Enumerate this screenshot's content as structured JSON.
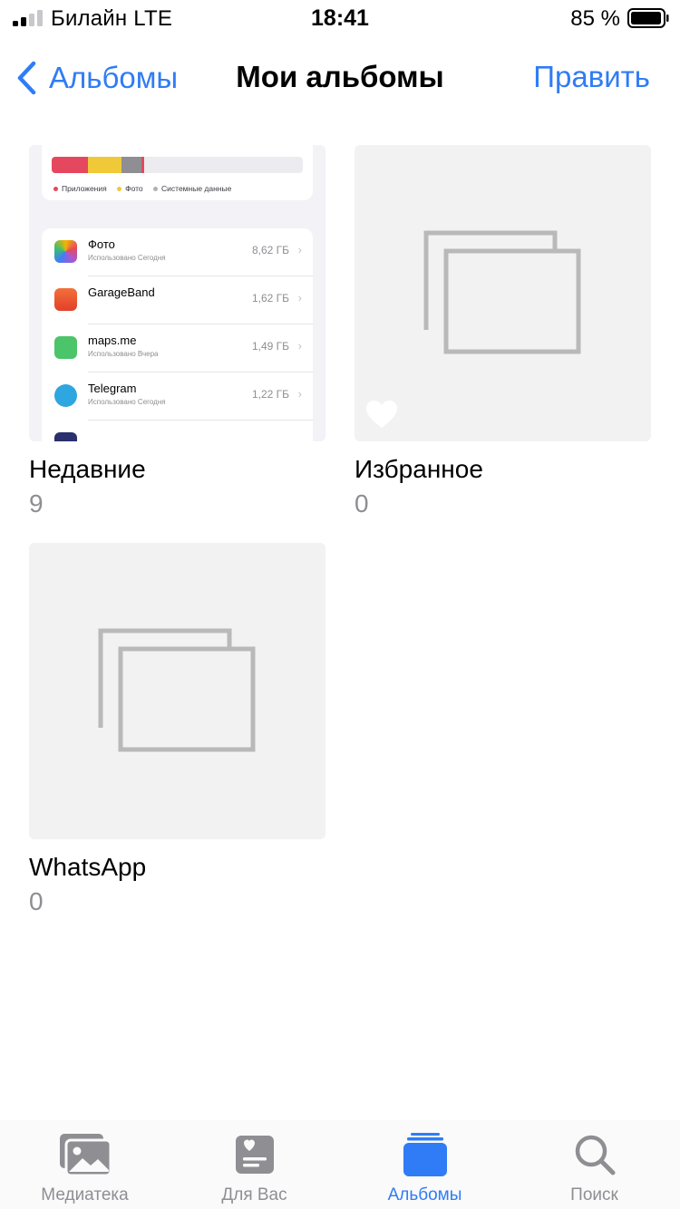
{
  "status_bar": {
    "carrier": "Билайн  LTE",
    "time": "18:41",
    "battery_percent": "85 %"
  },
  "nav": {
    "back_label": "Альбомы",
    "title": "Мои альбомы",
    "edit_label": "Править"
  },
  "albums": [
    {
      "name": "Недавние",
      "count": "9",
      "preview": {
        "legend": [
          "Приложения",
          "Фото",
          "Системные данные"
        ],
        "apps": [
          {
            "name": "Фото",
            "sub": "Использовано Сегодня",
            "size": "8,62 ГБ"
          },
          {
            "name": "GarageBand",
            "sub": "",
            "size": "1,62 ГБ"
          },
          {
            "name": "maps.me",
            "sub": "Использовано Вчера",
            "size": "1,49 ГБ"
          },
          {
            "name": "Telegram",
            "sub": "Использовано Сегодня",
            "size": "1,22 ГБ"
          }
        ]
      }
    },
    {
      "name": "Избранное",
      "count": "0"
    },
    {
      "name": "WhatsApp",
      "count": "0"
    }
  ],
  "tabbar": {
    "items": [
      {
        "label": "Медиатека",
        "icon": "photo-library-icon",
        "active": false
      },
      {
        "label": "Для Вас",
        "icon": "for-you-icon",
        "active": false
      },
      {
        "label": "Альбомы",
        "icon": "albums-icon",
        "active": true
      },
      {
        "label": "Поиск",
        "icon": "search-icon",
        "active": false
      }
    ]
  },
  "colors": {
    "accent": "#2f7cf6",
    "secondary_text": "#8e8e93",
    "placeholder_bg": "#f2f2f2"
  }
}
